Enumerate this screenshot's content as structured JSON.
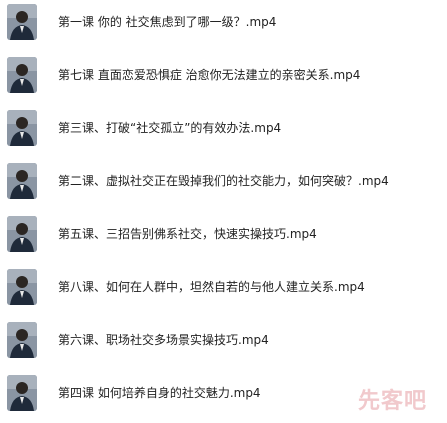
{
  "files": [
    {
      "name": "第一课 你的 社交焦虑到了哪一级？.mp4",
      "icon": "video-thumbnail-icon"
    },
    {
      "name": "第七课 直面恋爱恐惧症 治愈你无法建立的亲密关系.mp4",
      "icon": "video-thumbnail-icon"
    },
    {
      "name": "第三课、打破“社交孤立”的有效办法.mp4",
      "icon": "video-thumbnail-icon"
    },
    {
      "name": "第二课、虚拟社交正在毁掉我们的社交能力，如何突破？.mp4",
      "icon": "video-thumbnail-icon"
    },
    {
      "name": "第五课、三招告别佛系社交，快速实操技巧.mp4",
      "icon": "video-thumbnail-icon"
    },
    {
      "name": "第八课、如何在人群中，坦然自若的与他人建立关系.mp4",
      "icon": "video-thumbnail-icon"
    },
    {
      "name": "第六课、职场社交多场景实操技巧.mp4",
      "icon": "video-thumbnail-icon"
    },
    {
      "name": "第四课 如何培养自身的社交魅力.mp4",
      "icon": "video-thumbnail-icon"
    }
  ],
  "watermark": "先客吧",
  "colors": {
    "text": "#222222",
    "thumbnail_bg": "#8d97a3",
    "watermark": "#f1c9cc"
  }
}
